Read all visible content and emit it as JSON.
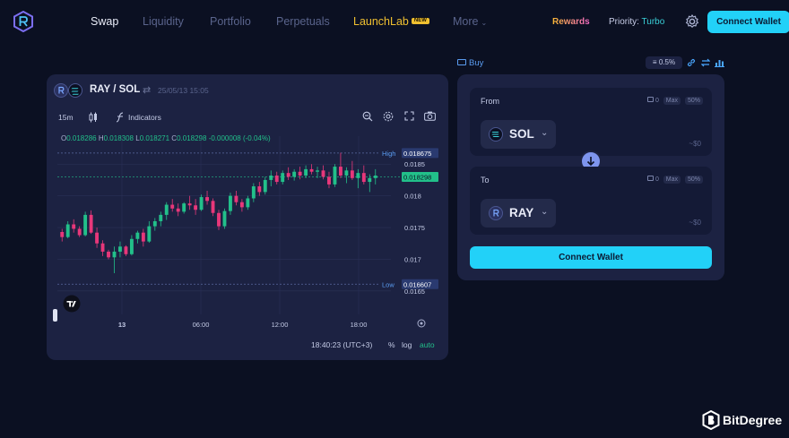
{
  "nav": {
    "items": [
      {
        "label": "Swap",
        "active": true
      },
      {
        "label": "Liquidity"
      },
      {
        "label": "Portfolio"
      },
      {
        "label": "Perpetuals"
      },
      {
        "label": "LaunchLab",
        "badge": "NEW"
      },
      {
        "label": "More"
      }
    ],
    "rewards": "Rewards",
    "priority_label": "Priority:",
    "priority_value": "Turbo",
    "connect_wallet": "Connect Wallet"
  },
  "chart_panel": {
    "pair": "RAY / SOL",
    "datetime": "25/05/13 15:05",
    "interval": "15m",
    "indicators": "Indicators",
    "ohlc": {
      "O": "0.018286",
      "H": "0.018308",
      "L": "0.018271",
      "C": "0.018298",
      "change": "-0.000008 (-0.04%)"
    },
    "price_labels": {
      "high_label": "High",
      "high_value": "0.018675",
      "current_value": "0.018298",
      "low_label": "Low",
      "low_value": "0.016607"
    },
    "y_ticks": [
      "0.0185",
      "0.018",
      "0.0175",
      "0.017",
      "0.0165"
    ],
    "x_ticks": [
      "13",
      "06:00",
      "12:00",
      "18:00"
    ],
    "clock": "18:40:23 (UTC+3)",
    "pct_label": "%",
    "log_label": "log",
    "auto_label": "auto"
  },
  "chart_data": {
    "type": "candlestick",
    "series_name": "RAY / SOL",
    "x_ticks": [
      "13",
      "06:00",
      "12:00",
      "18:00"
    ],
    "ylim": [
      0.0163,
      0.0188
    ],
    "candles": [
      [
        0.01743,
        0.01748,
        0.01728,
        0.01735
      ],
      [
        0.01735,
        0.0176,
        0.01733,
        0.01755
      ],
      [
        0.01755,
        0.01763,
        0.01742,
        0.01748
      ],
      [
        0.01748,
        0.01752,
        0.01735,
        0.01738
      ],
      [
        0.01738,
        0.01775,
        0.01736,
        0.0177
      ],
      [
        0.0177,
        0.01777,
        0.0174,
        0.01742
      ],
      [
        0.01742,
        0.0175,
        0.01718,
        0.01725
      ],
      [
        0.01725,
        0.0173,
        0.01705,
        0.01712
      ],
      [
        0.01712,
        0.01715,
        0.017,
        0.01703
      ],
      [
        0.01703,
        0.0172,
        0.01678,
        0.01712
      ],
      [
        0.01712,
        0.01728,
        0.01703,
        0.0172
      ],
      [
        0.0172,
        0.01722,
        0.01705,
        0.01708
      ],
      [
        0.01708,
        0.01738,
        0.01706,
        0.01732
      ],
      [
        0.01732,
        0.01745,
        0.01725,
        0.01742
      ],
      [
        0.01742,
        0.01748,
        0.0172,
        0.01728
      ],
      [
        0.01728,
        0.0176,
        0.01726,
        0.01752
      ],
      [
        0.01752,
        0.01765,
        0.01745,
        0.0176
      ],
      [
        0.0176,
        0.01775,
        0.01752,
        0.0177
      ],
      [
        0.0177,
        0.0179,
        0.01762,
        0.01786
      ],
      [
        0.01786,
        0.01795,
        0.01775,
        0.0178
      ],
      [
        0.0178,
        0.01788,
        0.01768,
        0.01775
      ],
      [
        0.01775,
        0.0179,
        0.01772,
        0.01788
      ],
      [
        0.01788,
        0.018,
        0.01778,
        0.01785
      ],
      [
        0.01785,
        0.01795,
        0.0177,
        0.01778
      ],
      [
        0.01778,
        0.01802,
        0.01776,
        0.01798
      ],
      [
        0.01798,
        0.01808,
        0.01786,
        0.01792
      ],
      [
        0.01792,
        0.01796,
        0.01768,
        0.01773
      ],
      [
        0.01773,
        0.01778,
        0.01746,
        0.01752
      ],
      [
        0.01752,
        0.0178,
        0.01748,
        0.01776
      ],
      [
        0.01776,
        0.01805,
        0.0177,
        0.018
      ],
      [
        0.018,
        0.01808,
        0.01785,
        0.0179
      ],
      [
        0.0179,
        0.01795,
        0.01775,
        0.01782
      ],
      [
        0.01782,
        0.018,
        0.01778,
        0.01796
      ],
      [
        0.01796,
        0.0182,
        0.0179,
        0.01815
      ],
      [
        0.01815,
        0.01822,
        0.018,
        0.01806
      ],
      [
        0.01806,
        0.0183,
        0.01802,
        0.01825
      ],
      [
        0.01825,
        0.0184,
        0.01815,
        0.01832
      ],
      [
        0.01832,
        0.01838,
        0.01818,
        0.01822
      ],
      [
        0.01822,
        0.0184,
        0.01818,
        0.01836
      ],
      [
        0.01836,
        0.01845,
        0.01825,
        0.0183
      ],
      [
        0.0183,
        0.01842,
        0.01824,
        0.01838
      ],
      [
        0.01838,
        0.01846,
        0.01826,
        0.01832
      ],
      [
        0.01832,
        0.01848,
        0.01828,
        0.01842
      ],
      [
        0.01842,
        0.0185,
        0.01834,
        0.01838
      ],
      [
        0.01838,
        0.01846,
        0.01828,
        0.0184
      ],
      [
        0.0184,
        0.01848,
        0.01826,
        0.0183
      ],
      [
        0.0183,
        0.01838,
        0.01812,
        0.01818
      ],
      [
        0.01818,
        0.0185,
        0.01814,
        0.01846
      ],
      [
        0.01846,
        0.01868,
        0.01828,
        0.01832
      ],
      [
        0.01832,
        0.01845,
        0.0182,
        0.0184
      ],
      [
        0.0184,
        0.01855,
        0.01825,
        0.01828
      ],
      [
        0.01828,
        0.01842,
        0.01812,
        0.01836
      ],
      [
        0.01836,
        0.01848,
        0.01818,
        0.01822
      ],
      [
        0.01822,
        0.01834,
        0.01806,
        0.01828
      ],
      [
        0.01828,
        0.01842,
        0.01818,
        0.01832
      ]
    ],
    "high": 0.018675,
    "low": 0.016607,
    "last": 0.018298,
    "grid": true
  },
  "swap_panel": {
    "tab": "Buy",
    "slippage": "0.5%",
    "from_label": "From",
    "to_label": "To",
    "wallet_balance": "0",
    "max_label": "Max",
    "half_label": "50%",
    "from_token": "SOL",
    "to_token": "RAY",
    "from_usd": "~$0",
    "to_usd": "~$0",
    "connect_wallet": "Connect Wallet"
  },
  "watermark": {
    "text": "BitDegree"
  },
  "colors": {
    "accent": "#22d1f8",
    "up": "#22c08a",
    "down": "#e8377a",
    "panel": "#1c2242",
    "bg": "#0b1022"
  }
}
